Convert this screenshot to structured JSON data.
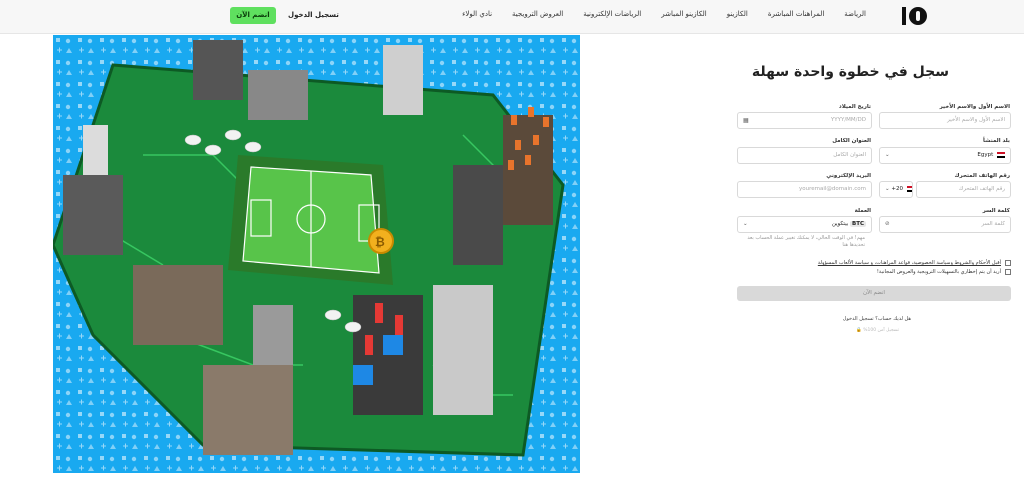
{
  "nav": {
    "items": [
      "الرياضة",
      "المراهنات المباشرة",
      "الكازينو",
      "الكازينو المباشر",
      "الرياضات الإلكترونية",
      "العروض الترويجية",
      "نادي الولاء"
    ],
    "login_label": "تسجيل الدخول",
    "join_label": "انضم الآن"
  },
  "form": {
    "title": "سجل في خطوة واحدة سهلة",
    "name_label": "الاسم الأول والاسم الأخير",
    "name_placeholder": "الاسم الأول والاسم الأخير",
    "dob_label": "تاريخ الميلاد",
    "dob_placeholder": "YYYY/MM/DD",
    "country_label": "بلد المنشأ",
    "country_value": "Egypt",
    "address_label": "العنوان الكامل",
    "address_placeholder": "العنوان الكامل",
    "phone_label": "رقم الهاتف المتحرك",
    "phone_code": "+20",
    "phone_placeholder": "رقم الهاتف المتحرك",
    "email_label": "البريد الإلكتروني",
    "email_placeholder": "youremail@domain.com",
    "password_label": "كلمة السر",
    "password_placeholder": "كلمة السر",
    "currency_label": "العملة",
    "currency_code": "BTC",
    "currency_value": "بيتكوين",
    "currency_hint": "مهم! في الوقت الحالي، لا يمكنك تغيير عملة الحساب بعد تحديدها هنا",
    "terms_text": "أقبل الأحكام والشروط وسياسة الخصوصية، قواعد المراهنات، و سياسة الألعاب المسؤولة",
    "promo_text": "أريد أن يتم إخطاري بالتسهيلات الترويجية والعروض المجانية!",
    "submit_label": "انضم الآن",
    "have_account": "هل لديك حساب؟ تسجيل الدخول",
    "secure_note": "تسجيل آمن 100% 🔒"
  },
  "colors": {
    "accent": "#5fe05f",
    "hero_bg": "#19a9f0",
    "board_green": "#1b8a3c"
  }
}
